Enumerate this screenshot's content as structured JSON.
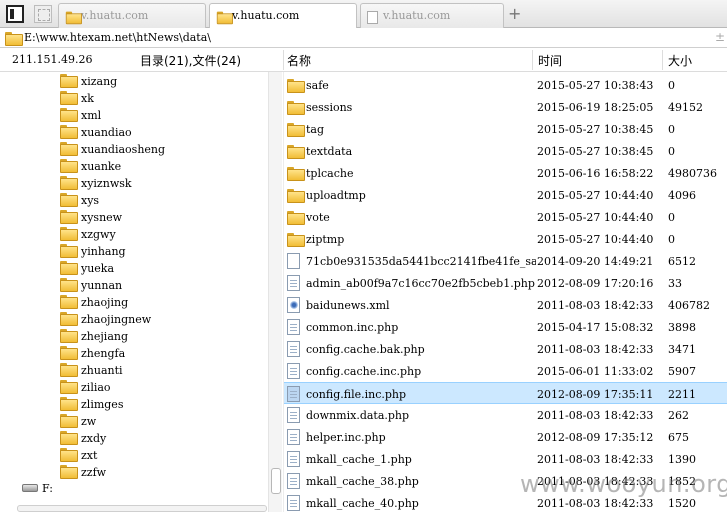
{
  "tabs": [
    {
      "label": "v.huatu.com",
      "icon": "folder-icon",
      "active": false
    },
    {
      "label": "v.huatu.com",
      "icon": "folder-icon",
      "active": true
    },
    {
      "label": "v.huatu.com",
      "icon": "page-icon",
      "active": false
    }
  ],
  "new_tab_label": "+",
  "path": "E:\\www.htexam.net\\htNews\\data\\",
  "header": {
    "ip": "211.151.49.26",
    "summary": "目录(21),文件(24)",
    "col_name": "名称",
    "col_time": "时间",
    "col_size": "大小"
  },
  "tree_items": [
    "xizang",
    "xk",
    "xml",
    "xuandiao",
    "xuandiaosheng",
    "xuanke",
    "xyiznwsk",
    "xys",
    "xysnew",
    "xzgwy",
    "yinhang",
    "yueka",
    "yunnan",
    "zhaojing",
    "zhaojingnew",
    "zhejiang",
    "zhengfa",
    "zhuanti",
    "ziliao",
    "zlimges",
    "zw",
    "zxdy",
    "zxt",
    "zzfw"
  ],
  "drive_label": "F:",
  "files": [
    {
      "name": "safe",
      "time": "2015-05-27 10:38:43",
      "size": "0",
      "icon": "folder-icon"
    },
    {
      "name": "sessions",
      "time": "2015-06-19 18:25:05",
      "size": "49152",
      "icon": "folder-icon"
    },
    {
      "name": "tag",
      "time": "2015-05-27 10:38:45",
      "size": "0",
      "icon": "folder-icon"
    },
    {
      "name": "textdata",
      "time": "2015-05-27 10:38:45",
      "size": "0",
      "icon": "folder-icon"
    },
    {
      "name": "tplcache",
      "time": "2015-06-16 16:58:22",
      "size": "4980736",
      "icon": "folder-icon"
    },
    {
      "name": "uploadtmp",
      "time": "2015-05-27 10:44:40",
      "size": "4096",
      "icon": "folder-icon"
    },
    {
      "name": "vote",
      "time": "2015-05-27 10:44:40",
      "size": "0",
      "icon": "folder-icon"
    },
    {
      "name": "ziptmp",
      "time": "2015-05-27 10:44:40",
      "size": "0",
      "icon": "folder-icon"
    },
    {
      "name": "71cb0e931535da5441bcc2141fbe41fe_sa...",
      "time": "2014-09-20 14:49:21",
      "size": "6512",
      "icon": "blank-file-icon"
    },
    {
      "name": "admin_ab00f9a7c16cc70e2fb5cbeb1.php",
      "time": "2012-08-09 17:20:16",
      "size": "33",
      "icon": "php-file-icon"
    },
    {
      "name": "baidunews.xml",
      "time": "2011-08-03 18:42:33",
      "size": "406782",
      "icon": "xml-file-icon"
    },
    {
      "name": "common.inc.php",
      "time": "2015-04-17 15:08:32",
      "size": "3898",
      "icon": "php-file-icon"
    },
    {
      "name": "config.cache.bak.php",
      "time": "2011-08-03 18:42:33",
      "size": "3471",
      "icon": "php-file-icon"
    },
    {
      "name": "config.cache.inc.php",
      "time": "2015-06-01 11:33:02",
      "size": "5907",
      "icon": "php-file-icon"
    },
    {
      "name": "config.file.inc.php",
      "time": "2012-08-09 17:35:11",
      "size": "2211",
      "icon": "php-file-icon",
      "selected": true
    },
    {
      "name": "downmix.data.php",
      "time": "2011-08-03 18:42:33",
      "size": "262",
      "icon": "php-file-icon"
    },
    {
      "name": "helper.inc.php",
      "time": "2012-08-09 17:35:12",
      "size": "675",
      "icon": "php-file-icon"
    },
    {
      "name": "mkall_cache_1.php",
      "time": "2011-08-03 18:42:33",
      "size": "1390",
      "icon": "php-file-icon"
    },
    {
      "name": "mkall_cache_38.php",
      "time": "2011-08-03 18:42:33",
      "size": "1852",
      "icon": "php-file-icon"
    },
    {
      "name": "mkall_cache_40.php",
      "time": "2011-08-03 18:42:33",
      "size": "1520",
      "icon": "php-file-icon"
    }
  ],
  "watermark": "www.wooyun.org",
  "colors": {
    "selection": "#cce8ff",
    "folder": "#f1bd36"
  }
}
